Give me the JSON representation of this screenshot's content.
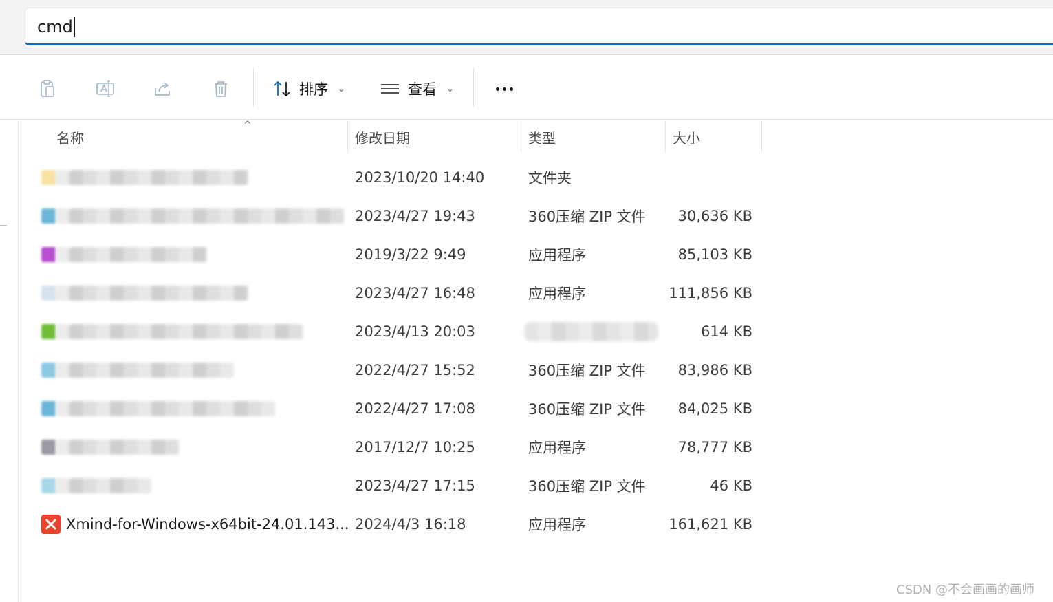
{
  "address": {
    "value": "cmd"
  },
  "toolbar": {
    "sort_label": "排序",
    "view_label": "查看",
    "chevron": "⌄"
  },
  "columns": {
    "name": "名称",
    "modified": "修改日期",
    "type": "类型",
    "size": "大小"
  },
  "files": [
    {
      "name": "",
      "date": "2023/10/20 14:40",
      "type": "文件夹",
      "size": "",
      "icon": "folder-icon",
      "icon_color": "#f8e3a3",
      "name_blurred": true
    },
    {
      "name": "",
      "date": "2023/4/27 19:43",
      "type": "360压缩 ZIP 文件",
      "size": "30,636 KB",
      "icon": "zip-icon",
      "icon_color": "#6cb6d9",
      "name_blurred": true
    },
    {
      "name": "",
      "date": "2019/3/22 9:49",
      "type": "应用程序",
      "size": "85,103 KB",
      "icon": "app-icon",
      "icon_color": "#b84fd0",
      "name_blurred": true
    },
    {
      "name": "",
      "date": "2023/4/27 16:48",
      "type": "应用程序",
      "size": "111,856 KB",
      "icon": "app-icon",
      "icon_color": "#d6e2ee",
      "name_blurred": true
    },
    {
      "name": "",
      "date": "2023/4/13 20:03",
      "type": "",
      "size": "614 KB",
      "icon": "file-icon",
      "icon_color": "#6fbf3a",
      "name_blurred": true,
      "type_blurred": true
    },
    {
      "name": "",
      "date": "2022/4/27 15:52",
      "type": "360压缩 ZIP 文件",
      "size": "83,986 KB",
      "icon": "zip-icon",
      "icon_color": "#8cc8e4",
      "name_blurred": true
    },
    {
      "name": "",
      "date": "2022/4/27 17:08",
      "type": "360压缩 ZIP 文件",
      "size": "84,025 KB",
      "icon": "zip-icon",
      "icon_color": "#6cb6d9",
      "name_blurred": true
    },
    {
      "name": "",
      "date": "2017/12/7 10:25",
      "type": "应用程序",
      "size": "78,777 KB",
      "icon": "app-icon",
      "icon_color": "#9a9aa2",
      "name_blurred": true
    },
    {
      "name": "",
      "date": "2023/4/27 17:15",
      "type": "360压缩 ZIP 文件",
      "size": "46 KB",
      "icon": "zip-icon",
      "icon_color": "#a8d8e8",
      "name_blurred": true
    },
    {
      "name": "Xmind-for-Windows-x64bit-24.01.143...",
      "date": "2024/4/3 16:18",
      "type": "应用程序",
      "size": "161,621 KB",
      "icon": "xmind-icon",
      "icon_color": "#e8432d",
      "name_blurred": false
    }
  ],
  "watermark": "CSDN @不会画画的画师",
  "colors": {
    "accent": "#0f6cbd",
    "disabled_icon": "#a9bccd"
  }
}
